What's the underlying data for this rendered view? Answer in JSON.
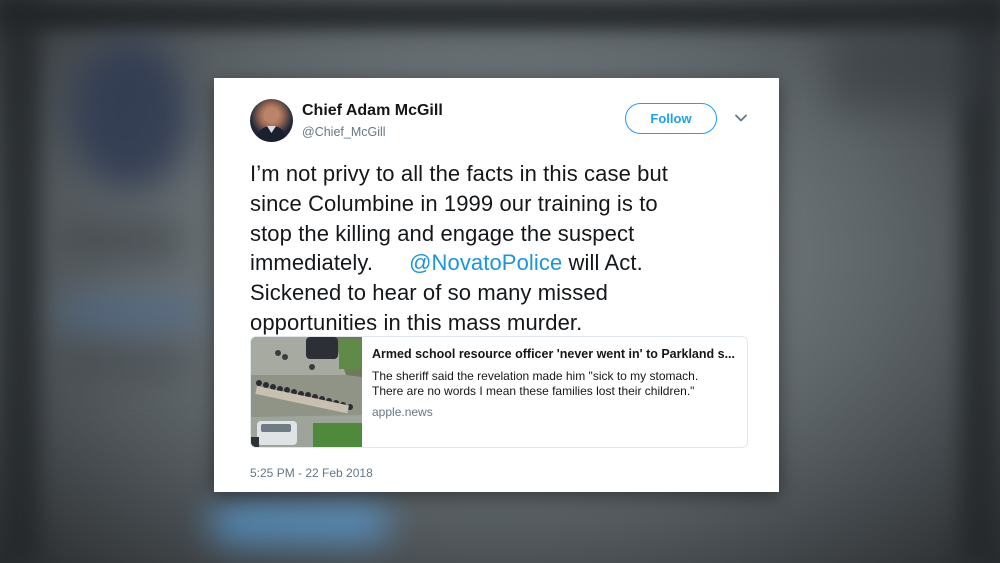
{
  "tweet": {
    "display_name": "Chief Adam McGill",
    "handle": "@Chief_McGill",
    "follow_label": "Follow",
    "text_lines": [
      "I’m not privy to all the facts in this case but",
      "since Columbine in 1999 our training is to",
      "stop the killing and engage the suspect",
      "immediately."
    ],
    "mention": "@NovatoPolice",
    "text_after_mention": " will Act.",
    "text_lines_end": [
      "Sickened to hear of so many missed",
      "opportunities in this mass murder."
    ],
    "timestamp": "5:25 PM - 22 Feb 2018"
  },
  "link_card": {
    "title": "Armed school resource officer 'never went in' to Parkland s...",
    "description_line1": "The sheriff said the revelation made him \"sick to my stomach.",
    "description_line2": "There are no words I mean these families lost their children.\"",
    "domain": "apple.news"
  },
  "colors": {
    "accent": "#1da1f2",
    "mention": "#1b95e0",
    "secondary_text": "#657786",
    "primary_text": "#14171a"
  },
  "icons": {
    "avatar": "avatar",
    "menu": "chevron-down-icon"
  }
}
